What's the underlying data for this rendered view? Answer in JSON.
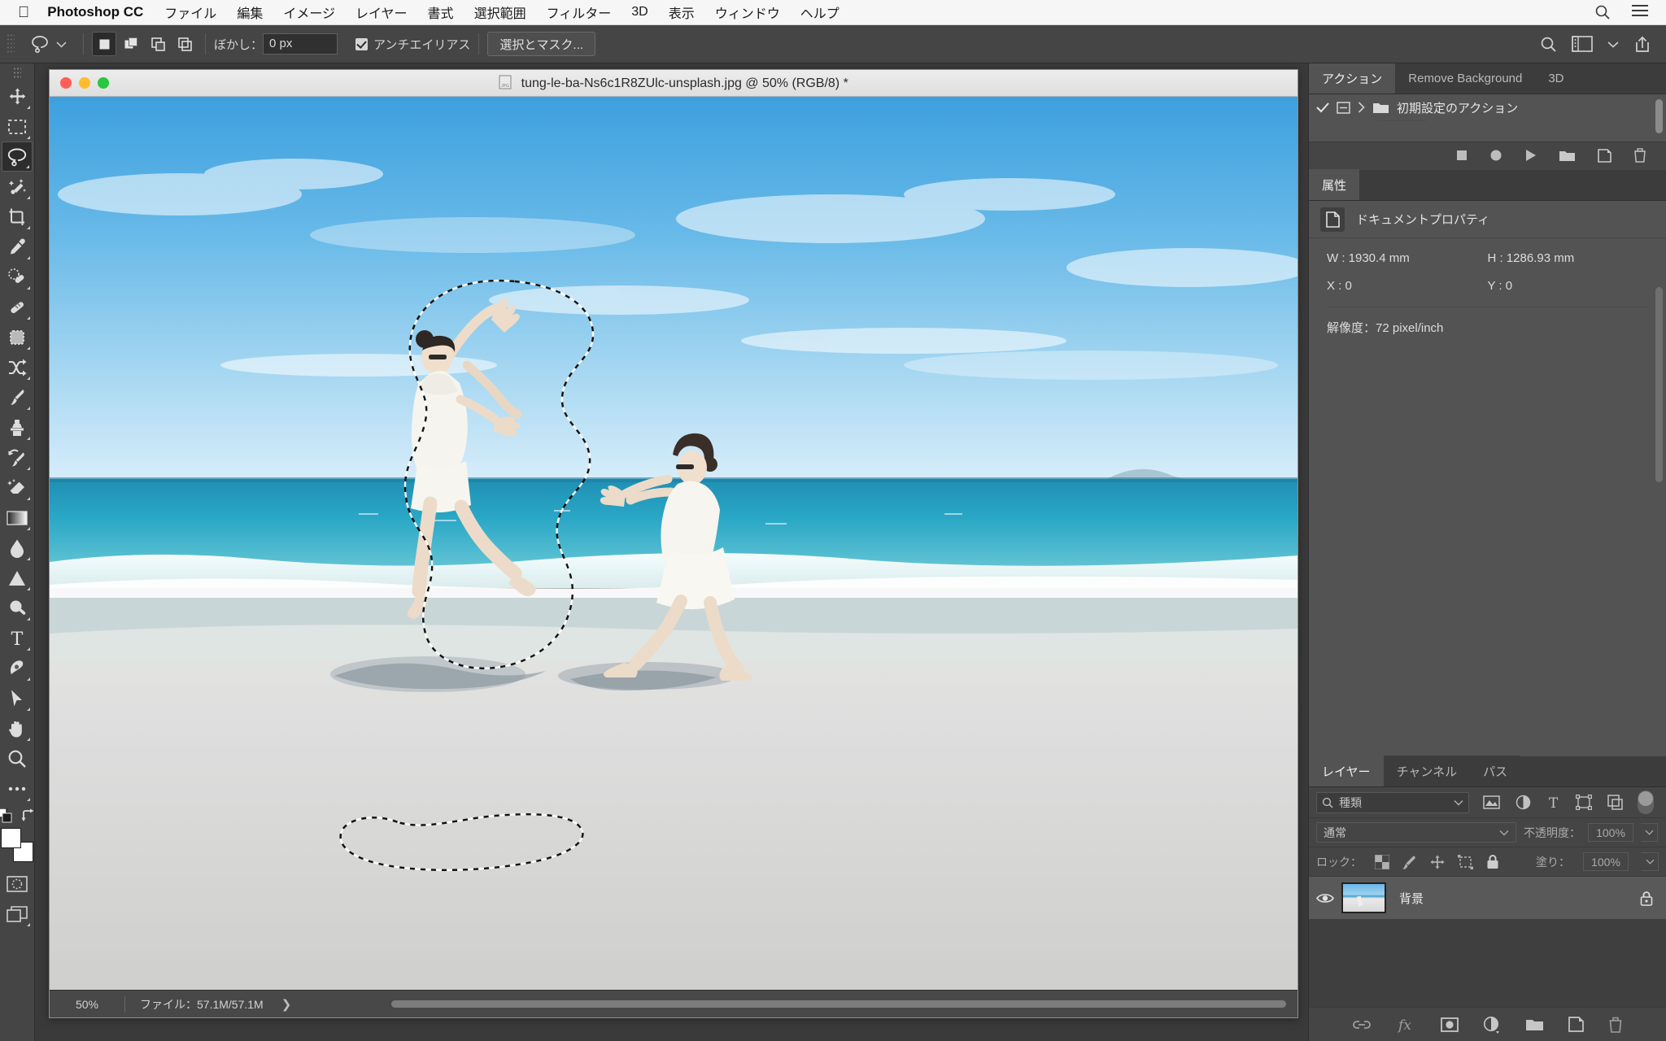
{
  "menubar": {
    "apple_icon": "apple-logo-icon",
    "app_name": "Photoshop CC",
    "items": [
      {
        "label": "ファイル"
      },
      {
        "label": "編集"
      },
      {
        "label": "イメージ"
      },
      {
        "label": "レイヤー"
      },
      {
        "label": "書式"
      },
      {
        "label": "選択範囲"
      },
      {
        "label": "フィルター"
      },
      {
        "label": "3D"
      },
      {
        "label": "表示"
      },
      {
        "label": "ウィンドウ"
      },
      {
        "label": "ヘルプ"
      }
    ],
    "right_icons": [
      "search-icon",
      "control-center-icon"
    ]
  },
  "options_bar": {
    "active_tool_icon": "lasso-tool-icon",
    "tool_preset_chevron": "chevron-down-icon",
    "selection_modes": [
      {
        "name": "new-selection",
        "active": true
      },
      {
        "name": "add-to-selection",
        "active": false
      },
      {
        "name": "subtract-from-selection",
        "active": false
      },
      {
        "name": "intersect-with-selection",
        "active": false
      }
    ],
    "feather_label": "ぼかし：",
    "feather_value": "0 px",
    "antialias_label": "アンチエイリアス",
    "antialias_checked": true,
    "select_and_mask_label": "選択とマスク...",
    "right_icons": [
      "search-icon",
      "workspace-icon",
      "chevron-down-icon",
      "share-icon"
    ]
  },
  "toolbar": {
    "tools": [
      {
        "name": "move-tool",
        "active": false
      },
      {
        "name": "rectangular-marquee-tool",
        "active": false
      },
      {
        "name": "lasso-tool",
        "active": true
      },
      {
        "name": "quick-selection-tool",
        "active": false
      },
      {
        "name": "crop-tool",
        "active": false
      },
      {
        "name": "eyedropper-tool",
        "active": false
      },
      {
        "name": "spot-healing-brush-tool",
        "active": false
      },
      {
        "name": "healing-brush-tool",
        "active": false
      },
      {
        "name": "patch-tool",
        "active": false
      },
      {
        "name": "shuffle-tool",
        "active": false
      },
      {
        "name": "brush-tool",
        "active": false
      },
      {
        "name": "clone-stamp-tool",
        "active": false
      },
      {
        "name": "history-brush-tool",
        "active": false
      },
      {
        "name": "eraser-tool",
        "active": false
      },
      {
        "name": "gradient-tool",
        "active": false
      },
      {
        "name": "blur-tool",
        "active": false
      },
      {
        "name": "dodge-tool",
        "active": false
      },
      {
        "name": "burn-tool",
        "active": false
      },
      {
        "name": "type-tool",
        "active": false
      },
      {
        "name": "pen-tool",
        "active": false
      },
      {
        "name": "path-selection-tool",
        "active": false
      },
      {
        "name": "hand-tool",
        "active": false
      },
      {
        "name": "zoom-tool",
        "active": false
      },
      {
        "name": "edit-toolbar-tool",
        "active": false
      }
    ],
    "foreground_color": "#ffffff",
    "background_color": "#ffffff",
    "swap_colors_icon": "swap-colors-icon",
    "default_colors_icon": "default-colors-icon",
    "quick_mask_icon": "quick-mask-icon",
    "screen_mode_icon": "screen-mode-icon"
  },
  "document": {
    "title": "tung-le-ba-Ns6c1R8ZUlc-unsplash.jpg @ 50% (RGB/8) *",
    "file_icon": "jpeg-file-icon",
    "traffic_lights": [
      "close-button",
      "minimize-button",
      "maximize-button"
    ],
    "status": {
      "zoom": "50%",
      "file_size_label": "ファイル：57.1M/57.1M",
      "expand_arrow": "chevron-right-icon"
    }
  },
  "actions_panel": {
    "tabs": [
      {
        "label": "アクション",
        "active": true
      },
      {
        "label": "Remove Background",
        "active": false
      },
      {
        "label": "3D",
        "active": false
      }
    ],
    "menu_icon": "panel-menu-icon",
    "rows": [
      {
        "checked": true,
        "expand_icon": "toggle-dialog-icon",
        "chevron": "chevron-right-icon",
        "folder_icon": "folder-icon",
        "label": "初期設定のアクション"
      }
    ],
    "toolbar_icons": [
      "stop-icon",
      "record-icon",
      "play-icon",
      "new-set-icon",
      "new-action-icon",
      "delete-icon"
    ]
  },
  "properties_panel": {
    "tabs": [
      {
        "label": "属性",
        "active": true
      }
    ],
    "menu_icon": "panel-menu-icon",
    "header_icon": "document-properties-icon",
    "header_label": "ドキュメントプロパティ",
    "fields": [
      {
        "label": "W : 1930.4 mm"
      },
      {
        "label": "H : 1286.93 mm"
      },
      {
        "label": "X : 0"
      },
      {
        "label": "Y : 0"
      }
    ],
    "resolution": "解像度：72 pixel/inch"
  },
  "layers_panel": {
    "tabs": [
      {
        "label": "レイヤー",
        "active": true
      },
      {
        "label": "チャンネル",
        "active": false
      },
      {
        "label": "パス",
        "active": false
      }
    ],
    "menu_icon": "panel-menu-icon",
    "filter": {
      "search_icon": "search-icon",
      "kind_label": "種類",
      "chevron": "chevron-down-icon",
      "filter_icons": [
        "pixel-layer-filter-icon",
        "adjustment-layer-filter-icon",
        "type-layer-filter-icon",
        "shape-layer-filter-icon",
        "smart-object-filter-icon"
      ],
      "toggle_name": "filter-toggle"
    },
    "blend_mode": "通常",
    "opacity_label": "不透明度：",
    "opacity_value": "100%",
    "lock_label": "ロック：",
    "lock_icons": [
      "lock-transparent-pixels-icon",
      "lock-image-pixels-icon",
      "lock-position-icon",
      "lock-artboard-icon",
      "lock-all-icon"
    ],
    "fill_label": "塗り：",
    "fill_value": "100%",
    "layers": [
      {
        "name": "背景",
        "visible": true,
        "locked": true,
        "thumbnail": "beach-photo-thumbnail"
      }
    ],
    "bottom_icons": [
      "link-layers-icon",
      "layer-style-fx-icon",
      "add-layer-mask-icon",
      "adjustment-layer-icon",
      "new-group-icon",
      "new-layer-icon",
      "delete-layer-icon"
    ]
  },
  "canvas": {
    "description": "beach-photo-with-lasso-selection",
    "selection_name": "lasso-marching-ants-selection"
  }
}
